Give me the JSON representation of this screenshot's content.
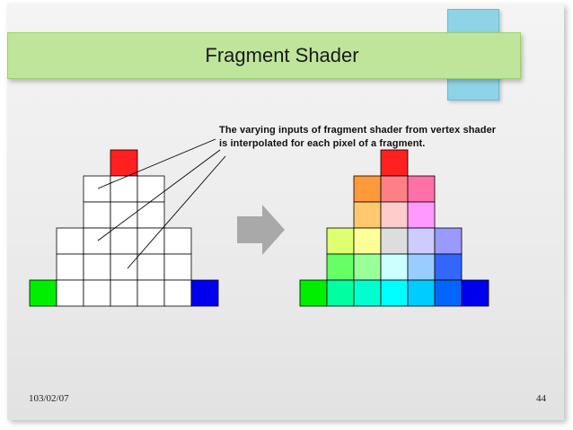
{
  "slide": {
    "title": "Fragment Shader",
    "note_line1": "The varying inputs of fragment shader from vertex shader",
    "note_line2": "is interpolated for each pixel of a fragment.",
    "footer_date": "103/02/07",
    "page_number": "44"
  },
  "colors": {
    "title_bar": "#bfe59a",
    "decor_box": "#8fd3e6",
    "arrow": "#a9a9a9",
    "grid_line": "#000000",
    "empty_cell": "#ffffff"
  },
  "left_triangle": {
    "rows": [
      [
        "#ff2020"
      ],
      [
        "#ffffff",
        "#ffffff",
        "#ffffff"
      ],
      [
        "#ffffff",
        "#ffffff",
        "#ffffff"
      ],
      [
        "#ffffff",
        "#ffffff",
        "#ffffff",
        "#ffffff",
        "#ffffff"
      ],
      [
        "#ffffff",
        "#ffffff",
        "#ffffff",
        "#ffffff",
        "#ffffff"
      ],
      [
        "#00ee00",
        "#ffffff",
        "#ffffff",
        "#ffffff",
        "#ffffff",
        "#ffffff",
        "#0000ee"
      ]
    ]
  },
  "right_triangle": {
    "rows": [
      [
        "#ff2020"
      ],
      [
        "#ff9a3c",
        "#ff7f86",
        "#ff6fa8"
      ],
      [
        "#ffc870",
        "#ffcccc",
        "#ff99ff"
      ],
      [
        "#ddff70",
        "#ffff99",
        "#dddddd",
        "#ccccff",
        "#9999ff"
      ],
      [
        "#66ff66",
        "#99ff99",
        "#ccffff",
        "#99ccff",
        "#3366ff"
      ],
      [
        "#00ee00",
        "#00ffa0",
        "#00ffd0",
        "#00ffff",
        "#00ccff",
        "#0066ff",
        "#0000ee"
      ]
    ]
  }
}
